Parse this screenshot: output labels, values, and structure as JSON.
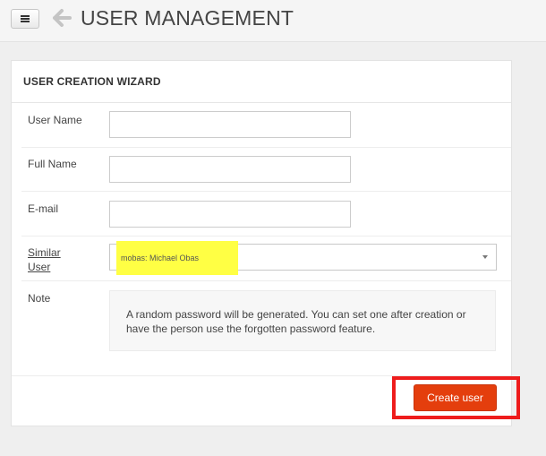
{
  "header": {
    "title": "USER MANAGEMENT",
    "menu_icon": "hamburger-icon",
    "back_icon": "arrow-left-icon"
  },
  "wizard": {
    "title": "USER CREATION WIZARD",
    "fields": {
      "user_name": {
        "label": "User Name",
        "value": ""
      },
      "full_name": {
        "label": "Full Name",
        "value": ""
      },
      "email": {
        "label": "E-mail",
        "value": ""
      },
      "similar_user": {
        "label_line1": "Similar",
        "label_line2": "User",
        "selected": "mobas: Michael Obas"
      },
      "note": {
        "label": "Note",
        "text": "A random password will be generated. You can set one after creation or have the person use the forgotten password feature."
      }
    },
    "create_button_label": "Create user"
  },
  "colors": {
    "accent": "#e43e0d",
    "highlight_yellow": "#ffff44",
    "highlight_red": "#ee1c1c"
  }
}
